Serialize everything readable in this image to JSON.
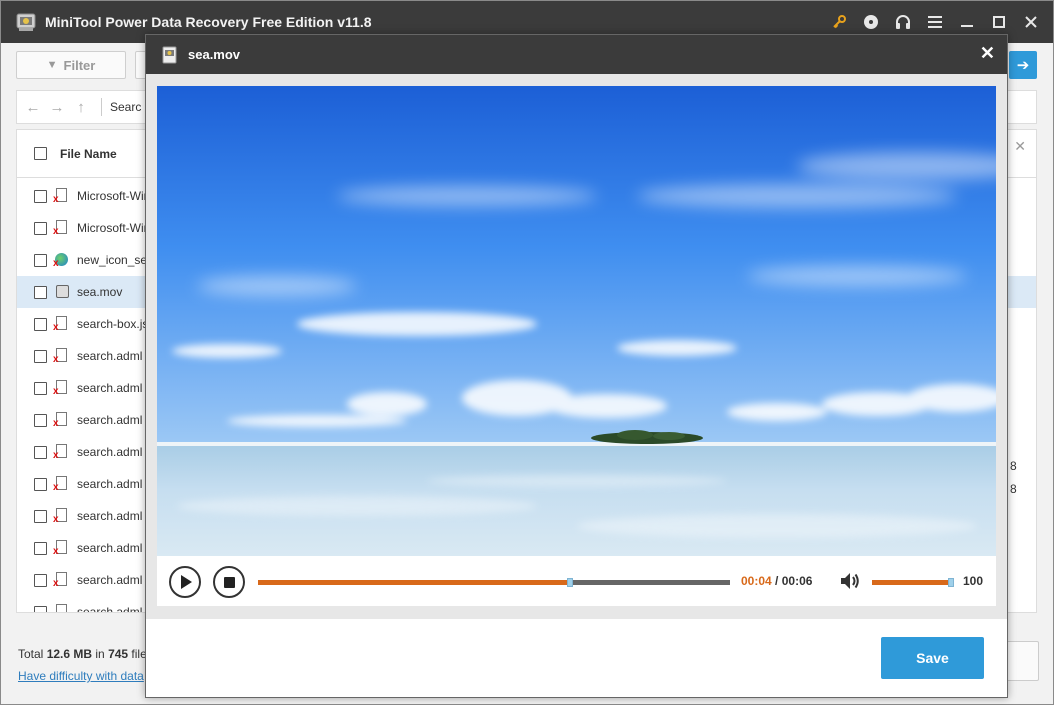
{
  "app": {
    "title": "MiniTool Power Data Recovery Free Edition v11.8",
    "title_icons": [
      "key-icon",
      "disc-icon",
      "headphones-icon",
      "menu-icon",
      "minimize-icon",
      "maximize-icon",
      "close-icon"
    ]
  },
  "toolbar": {
    "filter_label": "Filter"
  },
  "nav": {
    "path_text": "Searc"
  },
  "file_list": {
    "column_name": "File Name",
    "rows": [
      {
        "name": "Microsoft-Win",
        "icon": "app-deleted-icon"
      },
      {
        "name": "Microsoft-Win",
        "icon": "file-deleted-icon"
      },
      {
        "name": "new_icon_se",
        "icon": "edge-file-deleted-icon"
      },
      {
        "name": "sea.mov",
        "icon": "media-file-icon",
        "selected": true
      },
      {
        "name": "search-box.js",
        "icon": "file-deleted-icon"
      },
      {
        "name": "search.adml",
        "icon": "file-deleted-icon"
      },
      {
        "name": "search.adml",
        "icon": "file-deleted-icon"
      },
      {
        "name": "search.adml",
        "icon": "file-deleted-icon"
      },
      {
        "name": "search.adml",
        "icon": "file-deleted-icon"
      },
      {
        "name": "search.adml",
        "icon": "file-deleted-icon"
      },
      {
        "name": "search.adml",
        "icon": "file-deleted-icon"
      },
      {
        "name": "search.adml",
        "icon": "file-deleted-icon"
      },
      {
        "name": "search.adml",
        "icon": "file-deleted-icon"
      },
      {
        "name": "search.adml",
        "icon": "file-deleted-icon"
      }
    ],
    "side_values": [
      "8",
      "8"
    ]
  },
  "status": {
    "prefix": "Total ",
    "size": "12.6 MB",
    "middle": " in ",
    "count": "745",
    "suffix": " file",
    "help_link": "Have difficulty with data"
  },
  "preview": {
    "title": "sea.mov",
    "current_time": "00:04",
    "separator": " / ",
    "total_time": "00:06",
    "progress": 0.66,
    "volume": 100,
    "volume_label": "100",
    "save_label": "Save"
  },
  "colors": {
    "titlebar": "#3b3b3b",
    "accent": "#2f9ad9",
    "progress": "#d8691a",
    "link": "#2f7dbd"
  }
}
